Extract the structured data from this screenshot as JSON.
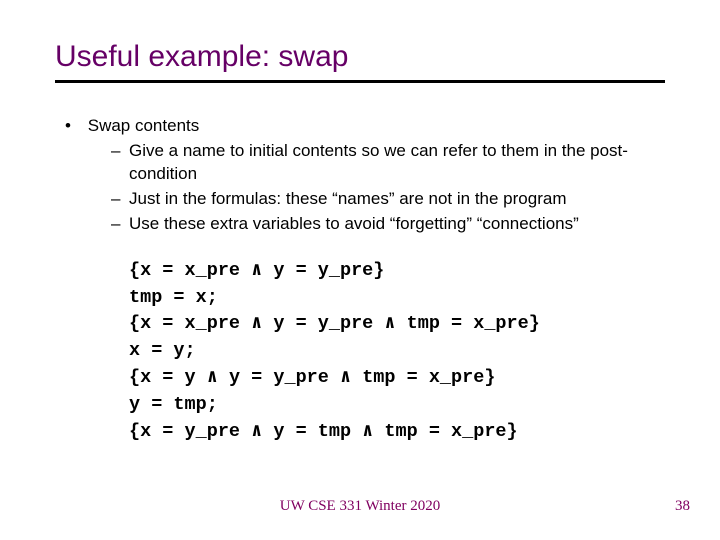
{
  "title": "Useful example: swap",
  "bullets": {
    "main": "Swap contents",
    "subs": [
      "Give a name to initial contents so we can refer to them in the post-condition",
      "Just in the formulas: these “names” are not in the program",
      "Use these extra variables to avoid “forgetting” “connections”"
    ]
  },
  "code": "{x = x_pre ∧ y = y_pre}\ntmp = x;\n{x = x_pre ∧ y = y_pre ∧ tmp = x_pre}\nx = y;\n{x = y ∧ y = y_pre ∧ tmp = x_pre}\ny = tmp;\n{x = y_pre ∧ y = tmp ∧ tmp = x_pre}",
  "footer": {
    "center": "UW CSE 331 Winter 2020",
    "page": "38"
  }
}
